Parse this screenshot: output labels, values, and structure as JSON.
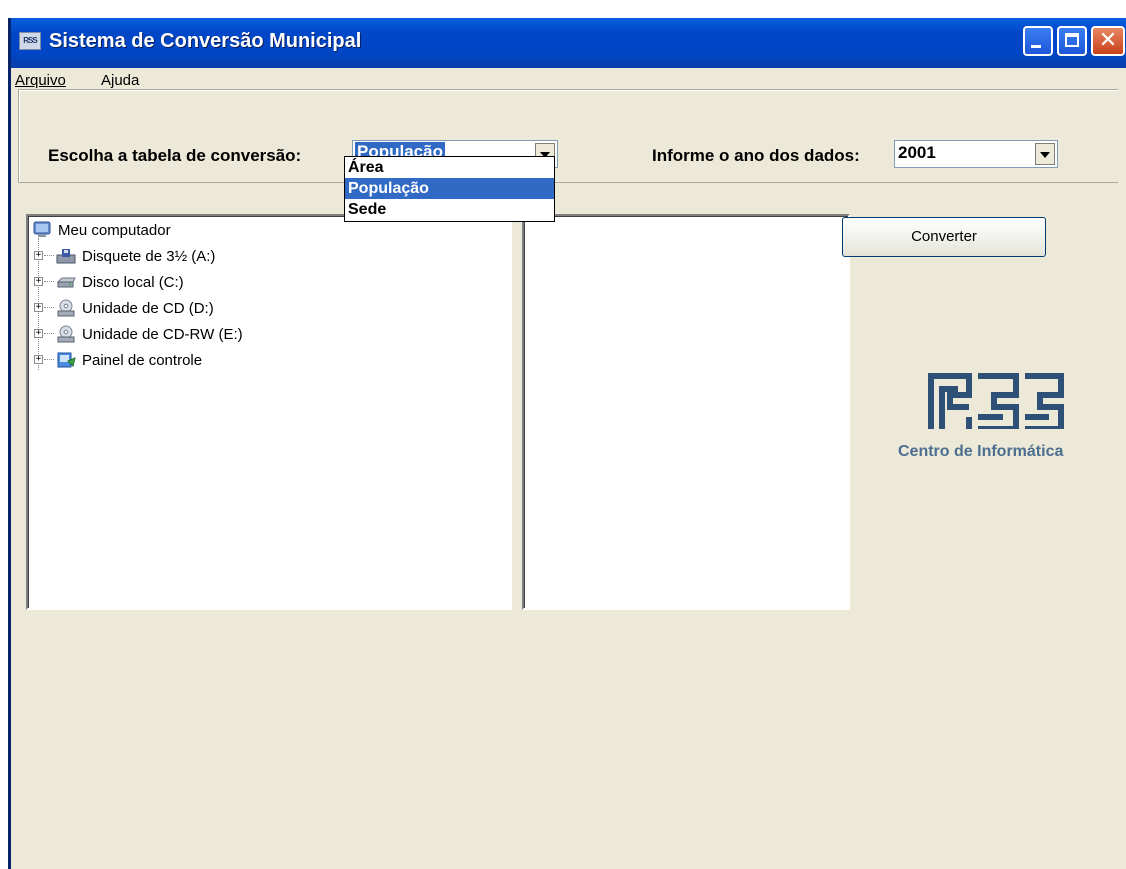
{
  "window": {
    "title": "Sistema de Conversão Municipal",
    "app_icon_text": "RSS"
  },
  "menu": {
    "items": [
      {
        "label": "Arquivo"
      },
      {
        "label": "Ajuda"
      }
    ]
  },
  "form": {
    "table_label": "Escolha a tabela de conversão:",
    "table_value": "População",
    "table_options": [
      "Área",
      "População",
      "Sede"
    ],
    "year_label": "Informe o ano dos dados:",
    "year_value": "2001"
  },
  "tree": {
    "root": "Meu computador",
    "items": [
      {
        "label": "Disquete de 3½ (A:)",
        "icon": "floppy-drive-icon"
      },
      {
        "label": "Disco local (C:)",
        "icon": "hard-disk-icon"
      },
      {
        "label": "Unidade de CD (D:)",
        "icon": "cd-drive-icon"
      },
      {
        "label": "Unidade de CD-RW (E:)",
        "icon": "cd-rw-drive-icon"
      },
      {
        "label": "Painel de controle",
        "icon": "control-panel-icon"
      }
    ]
  },
  "actions": {
    "convert_label": "Converter"
  },
  "logo": {
    "caption": "Centro de Informática"
  },
  "colors": {
    "titlebar": "#0047c8",
    "selection": "#316ac5",
    "face": "#ece9d8",
    "logo": "#2e4f76"
  }
}
